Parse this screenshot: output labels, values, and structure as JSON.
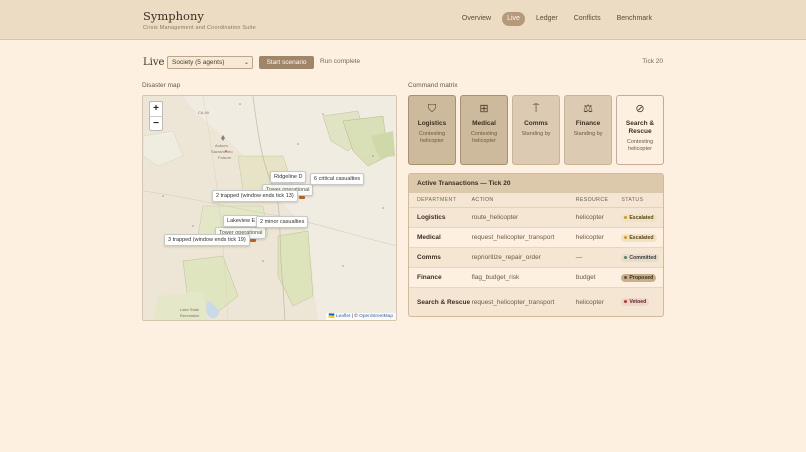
{
  "header": {
    "brand": "Symphony",
    "tagline": "Crisis Management and Coordination Suite",
    "nav": [
      "Overview",
      "Live",
      "Ledger",
      "Conflicts",
      "Benchmark"
    ],
    "active_nav": "Live"
  },
  "toolbar": {
    "title": "Live",
    "society_select": "Society (5 agents)",
    "start_label": "Start scenario",
    "run_status": "Run complete",
    "tick": "Tick 20"
  },
  "map": {
    "label": "Disaster map",
    "zoom_in": "+",
    "zoom_out": "−",
    "labels": {
      "ca": "CA 49",
      "sub1": "Auburn",
      "sub2": "Sacramento",
      "sub3": "Folsom",
      "sub4": "Lake State",
      "sub5": "Recreation"
    },
    "tooltips": {
      "ridgeline": "Ridgeline D",
      "tower_1": "Tower operational",
      "critical": "6 critical casualties",
      "trapped_2": "2 trapped (window ends tick 13)",
      "lakeview": "Lakeview E",
      "minor": "2 minor casualties",
      "tower_2": "Tower operational",
      "trapped_3": "3 trapped (window ends tick 19)"
    },
    "attribution": {
      "flag": "🇺🇦",
      "leaflet": "Leaflet",
      "sep": " | © ",
      "osm": "OpenStreetMap"
    }
  },
  "matrix": {
    "label": "Command matrix",
    "cards": [
      {
        "name": "Logistics",
        "status": "Contesting helicopter",
        "icon": "shield-icon",
        "glyph": "⛉",
        "state": "contest"
      },
      {
        "name": "Medical",
        "status": "Contesting helicopter",
        "icon": "medical-grid-icon",
        "glyph": "⊞",
        "state": "contest"
      },
      {
        "name": "Comms",
        "status": "Standing by",
        "icon": "antenna-icon",
        "glyph": "⍑",
        "state": "idle"
      },
      {
        "name": "Finance",
        "status": "Standing by",
        "icon": "scale-icon",
        "glyph": "⚖",
        "state": "idle"
      },
      {
        "name": "Search & Rescue",
        "status": "Contesting helicopter",
        "icon": "compass-icon",
        "glyph": "⊘",
        "state": "free"
      }
    ]
  },
  "transactions": {
    "title": "Active Transactions — Tick 20",
    "columns": [
      "DEPARTMENT",
      "ACTION",
      "RESOURCE",
      "STATUS"
    ],
    "rows": [
      {
        "department": "Logistics",
        "action": "route_helicopter",
        "resource": "helicopter",
        "status": "Escalated"
      },
      {
        "department": "Medical",
        "action": "request_helicopter_transport",
        "resource": "helicopter",
        "status": "Escalated"
      },
      {
        "department": "Comms",
        "action": "reprioritize_repair_order",
        "resource": "—",
        "status": "Committed"
      },
      {
        "department": "Finance",
        "action": "flag_budget_risk",
        "resource": "budget",
        "status": "Proposed"
      },
      {
        "department": "Search & Rescue",
        "action": "request_helicopter_transport",
        "resource": "helicopter",
        "status": "Vetoed"
      }
    ]
  }
}
